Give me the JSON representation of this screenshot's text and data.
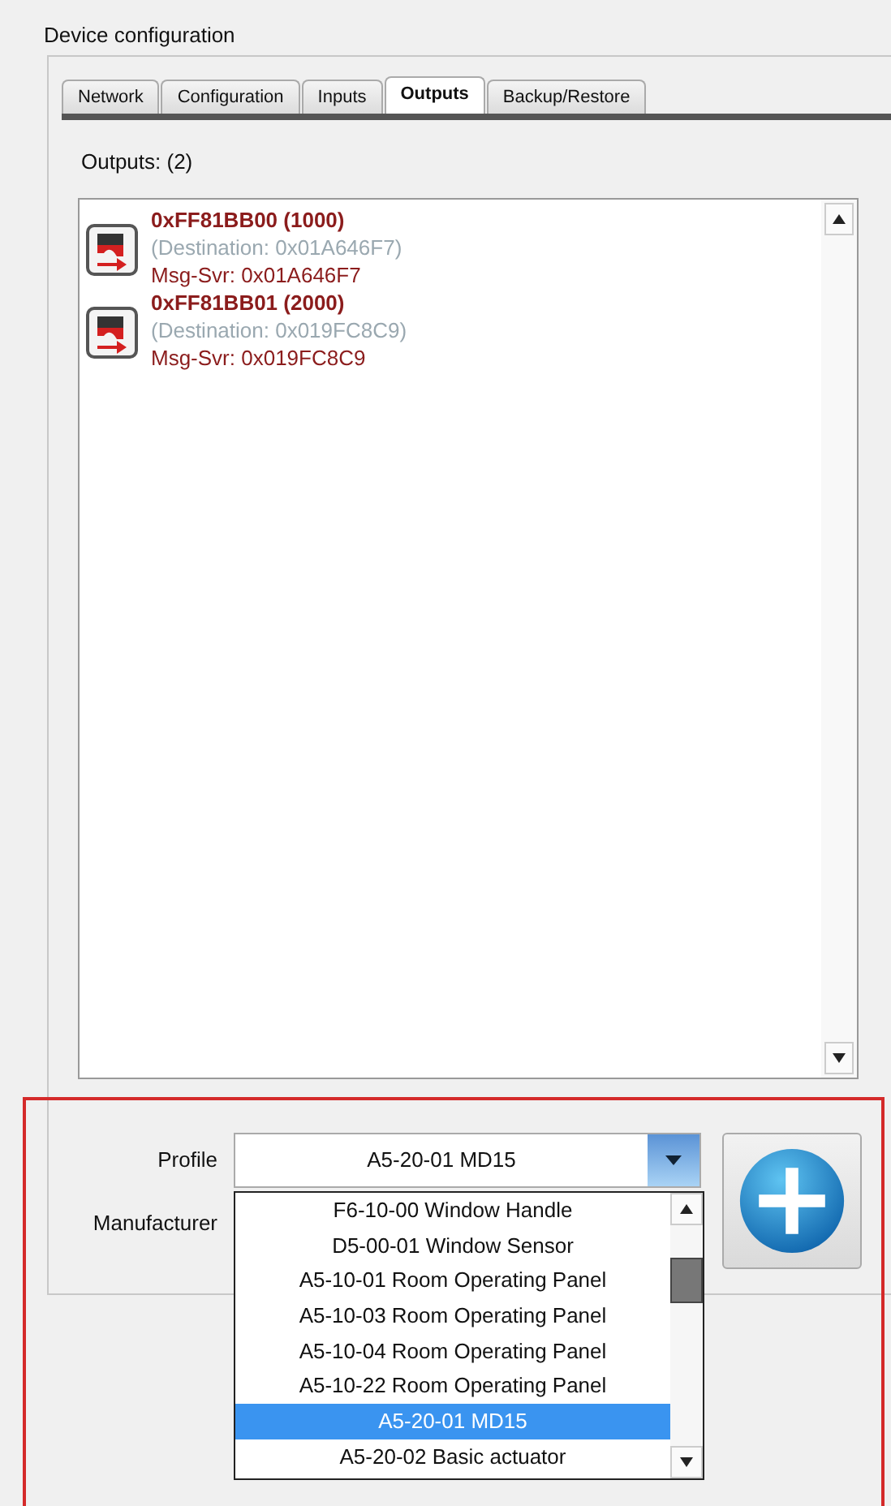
{
  "group_title": "Device configuration",
  "tabs": [
    {
      "label": "Network",
      "selected": false
    },
    {
      "label": "Configuration",
      "selected": false
    },
    {
      "label": "Inputs",
      "selected": false
    },
    {
      "label": "Outputs",
      "selected": true
    },
    {
      "label": "Backup/Restore",
      "selected": false
    }
  ],
  "outputs_label": "Outputs: (2)",
  "outputs": [
    {
      "title": "0xFF81BB00 (1000)",
      "destination": "(Destination: 0x01A646F7)",
      "server": "Msg-Svr: 0x01A646F7"
    },
    {
      "title": "0xFF81BB01 (2000)",
      "destination": "(Destination: 0x019FC8C9)",
      "server": "Msg-Svr: 0x019FC8C9"
    }
  ],
  "profile": {
    "label": "Profile",
    "value": "A5-20-01 MD15"
  },
  "manufacturer": {
    "label": "Manufacturer"
  },
  "profile_options": [
    {
      "label": "F6-10-00 Window Handle",
      "selected": false
    },
    {
      "label": "D5-00-01 Window Sensor",
      "selected": false
    },
    {
      "label": "A5-10-01 Room Operating Panel",
      "selected": false
    },
    {
      "label": "A5-10-03 Room Operating Panel",
      "selected": false
    },
    {
      "label": "A5-10-04 Room Operating Panel",
      "selected": false
    },
    {
      "label": "A5-10-22 Room Operating Panel",
      "selected": false
    },
    {
      "label": "A5-20-01 MD15",
      "selected": true
    },
    {
      "label": "A5-20-02 Basic actuator",
      "selected": false
    }
  ]
}
